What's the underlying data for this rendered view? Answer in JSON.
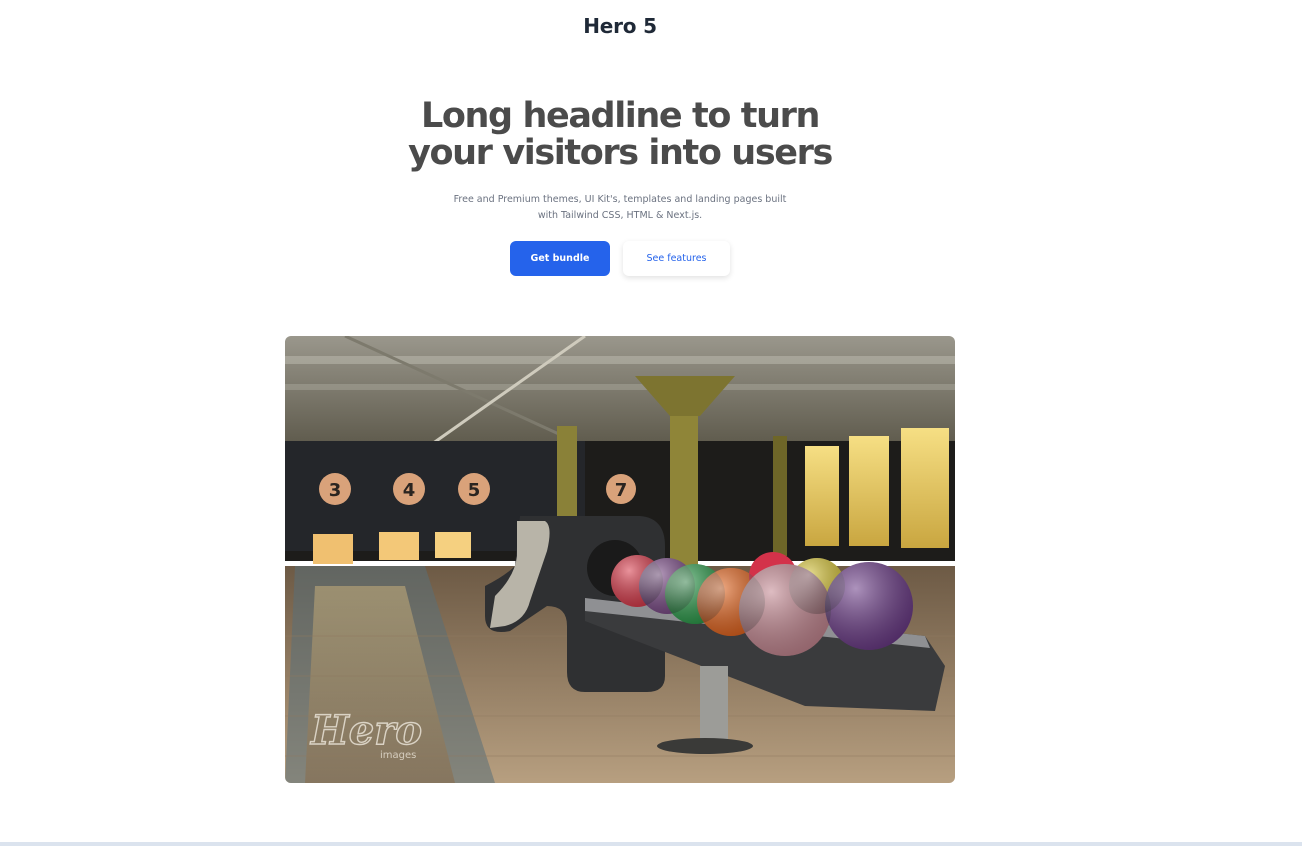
{
  "page": {
    "title": "Hero 5"
  },
  "hero": {
    "headline_line1": "Long headline to turn",
    "headline_line2": "your visitors into users",
    "subtext": "Free and Premium themes, UI Kit's, templates and landing pages built with Tailwind CSS, HTML & Next.js.",
    "primary_button_label": "Get bundle",
    "secondary_button_label": "See features"
  },
  "image": {
    "alt": "Bowling alley with ball return rack",
    "watermark_main": "Hero",
    "watermark_sub": "images",
    "lane_numbers": [
      "3",
      "4",
      "5",
      "7"
    ]
  },
  "colors": {
    "accent": "#2563eb",
    "headline": "#4b4b4b",
    "body_text": "#6b7280"
  }
}
